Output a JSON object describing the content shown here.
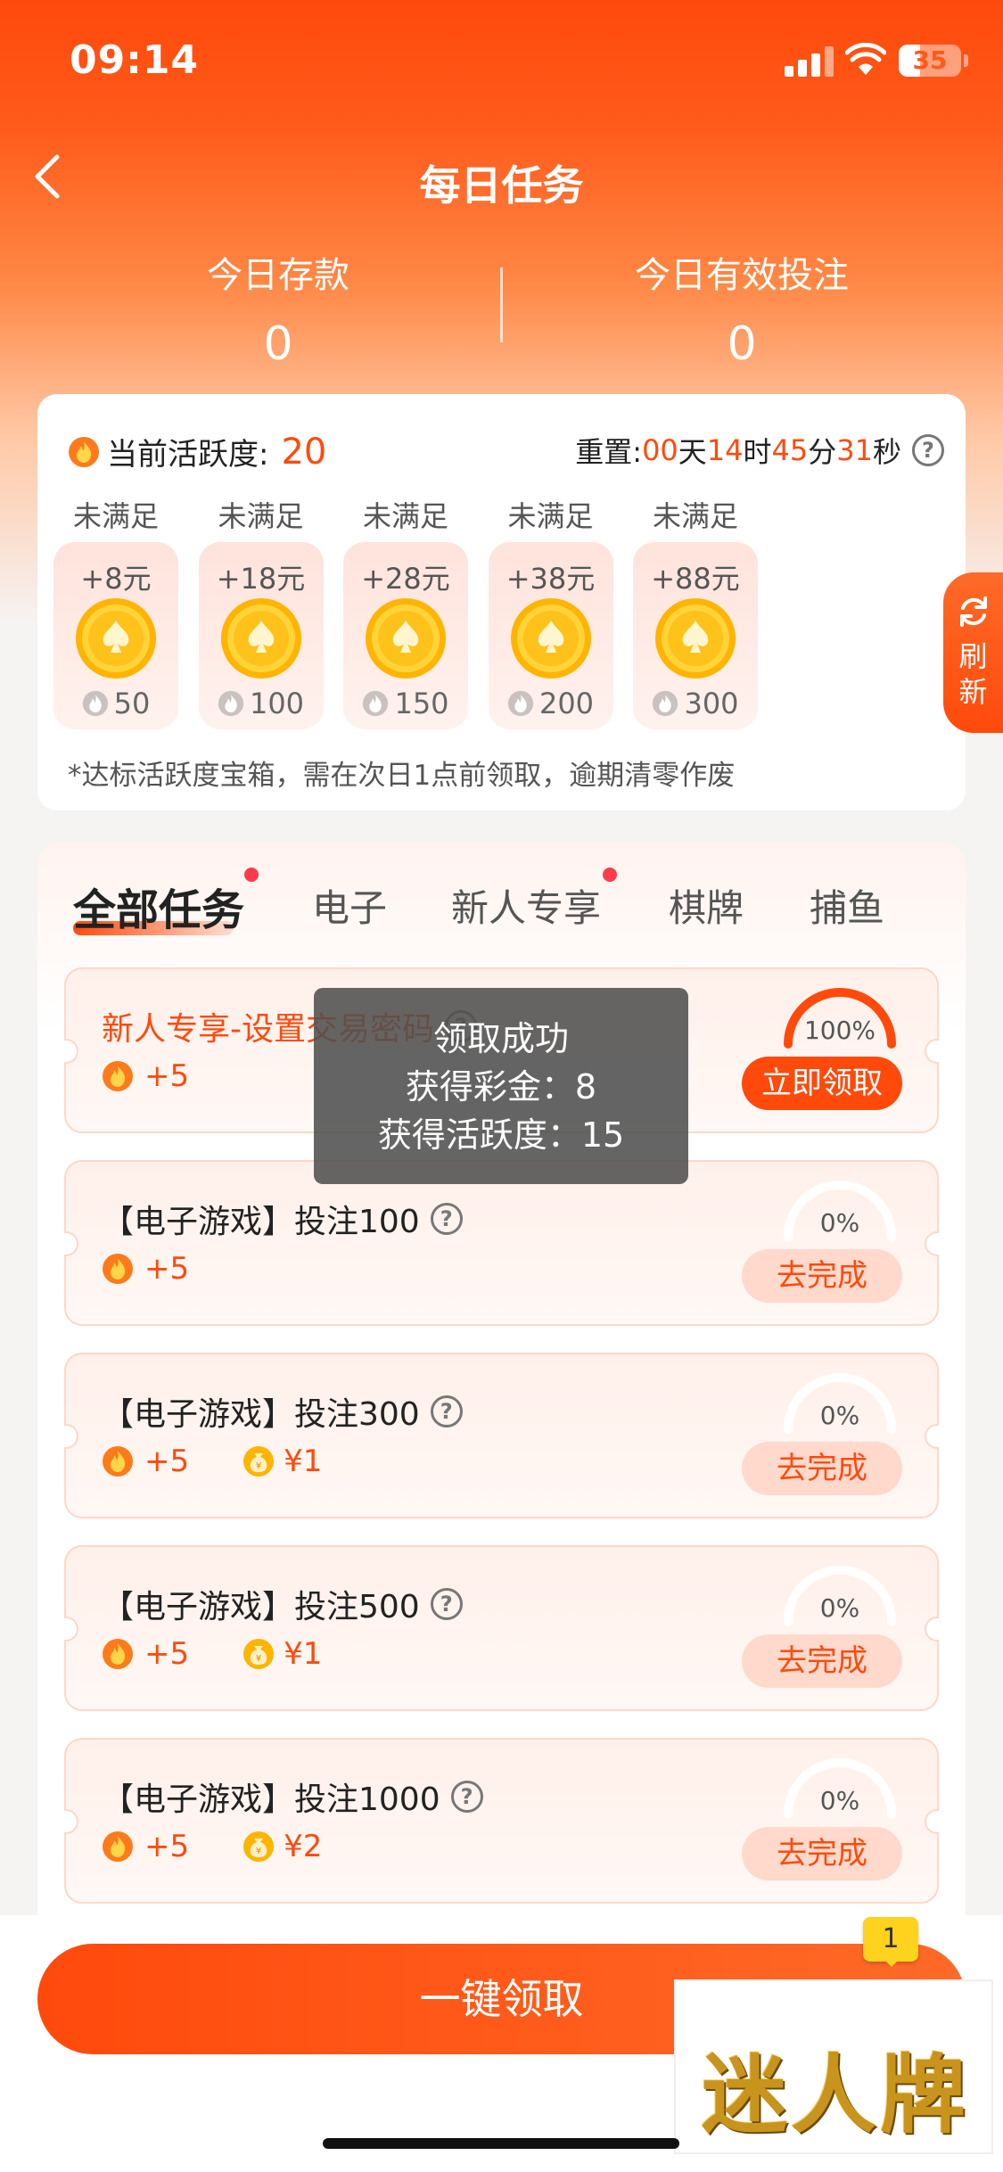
{
  "status_bar": {
    "time": "09:14",
    "battery": "35"
  },
  "header": {
    "title": "每日任务"
  },
  "stats": [
    {
      "label": "今日存款",
      "value": "0"
    },
    {
      "label": "今日有效投注",
      "value": "0"
    }
  ],
  "activity": {
    "label": "当前活跃度:",
    "value": "20",
    "reset_label": "重置:",
    "days": "00",
    "days_unit": "天",
    "hours": "14",
    "hours_unit": "时",
    "minutes": "45",
    "minutes_unit": "分",
    "seconds": "31",
    "seconds_unit": "秒",
    "chests": [
      {
        "status": "未满足",
        "reward": "+8元",
        "required": "50"
      },
      {
        "status": "未满足",
        "reward": "+18元",
        "required": "100"
      },
      {
        "status": "未满足",
        "reward": "+28元",
        "required": "150"
      },
      {
        "status": "未满足",
        "reward": "+38元",
        "required": "200"
      },
      {
        "status": "未满足",
        "reward": "+88元",
        "required": "300"
      }
    ],
    "note": "*达标活跃度宝箱，需在次日1点前领取，逾期清零作废"
  },
  "refresh": {
    "label1": "刷",
    "label2": "新"
  },
  "tabs": [
    {
      "label": "全部任务",
      "active": true,
      "dot": true
    },
    {
      "label": "电子",
      "active": false,
      "dot": false
    },
    {
      "label": "新人专享",
      "active": false,
      "dot": true
    },
    {
      "label": "棋牌",
      "active": false,
      "dot": false
    },
    {
      "label": "捕鱼",
      "active": false,
      "dot": false
    }
  ],
  "tasks": [
    {
      "title": "新人专享-设置交易密码",
      "activity": "+5",
      "bonus": "",
      "progress": "100%",
      "progress_value": 1.0,
      "button": "立即领取",
      "state": "claim"
    },
    {
      "title": "【电子游戏】投注100",
      "activity": "+5",
      "bonus": "",
      "progress": "0%",
      "progress_value": 0,
      "button": "去完成",
      "state": "go"
    },
    {
      "title": "【电子游戏】投注300",
      "activity": "+5",
      "bonus": "¥1",
      "progress": "0%",
      "progress_value": 0,
      "button": "去完成",
      "state": "go"
    },
    {
      "title": "【电子游戏】投注500",
      "activity": "+5",
      "bonus": "¥1",
      "progress": "0%",
      "progress_value": 0,
      "button": "去完成",
      "state": "go"
    },
    {
      "title": "【电子游戏】投注1000",
      "activity": "+5",
      "bonus": "¥2",
      "progress": "0%",
      "progress_value": 0,
      "button": "去完成",
      "state": "go"
    }
  ],
  "toast": {
    "line1": "领取成功",
    "line2": "获得彩金：8",
    "line3": "获得活跃度：15"
  },
  "claim_all": "一键领取",
  "badge": "1",
  "watermark": "迷人牌",
  "colors": {
    "accent": "#ff4a0c",
    "tab_dot": "#ff3a4a",
    "coin": "#ffc21a"
  }
}
